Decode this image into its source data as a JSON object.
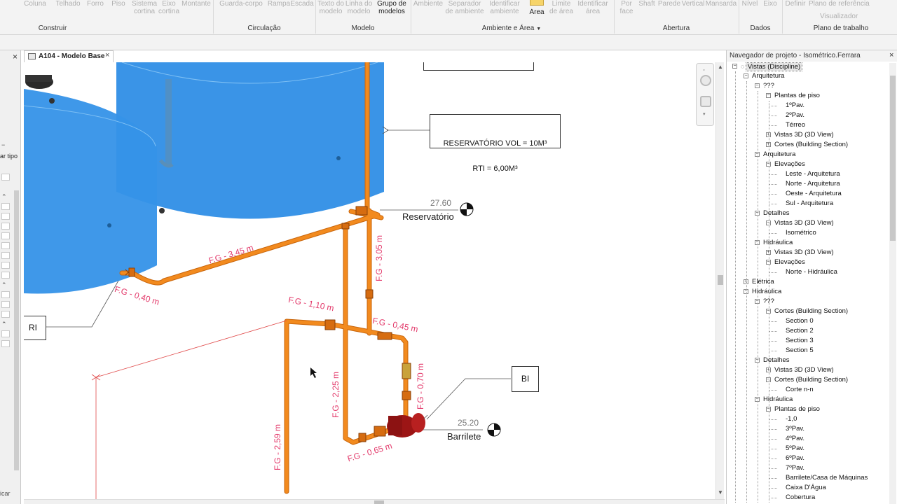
{
  "ribbon": {
    "buttons": [
      {
        "label": "Coluna",
        "active": false
      },
      {
        "label": "Telhado",
        "active": false
      },
      {
        "label": "Forro",
        "active": false
      },
      {
        "label": "Piso",
        "active": false
      },
      {
        "label": "Sistema\ncortina",
        "active": false
      },
      {
        "label": "Eixo\ncortina",
        "active": false
      },
      {
        "label": "Montante",
        "active": false
      },
      {
        "label": "Guarda-corpo",
        "active": false
      },
      {
        "label": "Rampa",
        "active": false
      },
      {
        "label": "Escada",
        "active": false
      },
      {
        "label": "Texto do\nmodelo",
        "active": false
      },
      {
        "label": "Linha do\nmodelo",
        "active": false
      },
      {
        "label": "Grupo de\nmodelos",
        "active": true
      },
      {
        "label": "Ambiente",
        "active": false
      },
      {
        "label": "Separador\nde ambiente",
        "active": false
      },
      {
        "label": "Identificar\nambiente",
        "active": false
      },
      {
        "label": "Área",
        "active": true
      },
      {
        "label": "Limite\nde área",
        "active": false
      },
      {
        "label": "Identificar\nárea",
        "active": false
      },
      {
        "label": "Por\nface",
        "active": false
      },
      {
        "label": "Shaft",
        "active": false
      },
      {
        "label": "Parede",
        "active": false
      },
      {
        "label": "Vertical",
        "active": false
      },
      {
        "label": "Mansarda",
        "active": false
      },
      {
        "label": "Nível",
        "active": false
      },
      {
        "label": "Eixo",
        "active": false
      },
      {
        "label": "Definir",
        "active": false
      },
      {
        "label": "Plano de referência",
        "active": false
      },
      {
        "label": "Visualizador",
        "active": false
      }
    ],
    "panels": [
      "Construir",
      "Circulação",
      "Modelo",
      "Ambiente e Área",
      "Abertura",
      "Dados",
      "Plano de trabalho"
    ]
  },
  "left_panel": {
    "type_label": "ar tipo",
    "footer_label": "icar"
  },
  "view_tab": {
    "label": "A104 - Modelo Base",
    "close": "×"
  },
  "canvas": {
    "pipe_labels": [
      "F.G - 3,45 m",
      "F.G - 0,40 m",
      "F.G - 3,05 m",
      "F.G - 1,10 m",
      "F.G - 0,45 m",
      "F.G - 0,70 m",
      "F.G - 2,25 m",
      "F.G - 2,59 m",
      "F.G - 0,65 m"
    ],
    "reservoir_note_line1": "RESERVATÓRIO VOL = 10M³",
    "reservoir_note_line2": "RTI = 6,00M³",
    "level_reservatorio_value": "27.60",
    "level_reservatorio_name": "Reservatório",
    "level_barrilete_value": "25.20",
    "level_barrilete_name": "Barrilete",
    "tag_bi": "BI",
    "tag_ri": "RI"
  },
  "browser": {
    "title": "Navegador de projeto - Isométrico.Ferrara",
    "close": "×",
    "items": [
      {
        "label": "Vistas (Discipline)",
        "toggle": "-",
        "selected": true
      },
      {
        "label": "Arquitetura",
        "toggle": "-"
      },
      {
        "label": "???",
        "toggle": "-"
      },
      {
        "label": "Plantas de piso",
        "toggle": "-"
      },
      {
        "label": "1ºPav.",
        "toggle": ""
      },
      {
        "label": "2ºPav.",
        "toggle": ""
      },
      {
        "label": "Térreo",
        "toggle": ""
      },
      {
        "label": "Vistas 3D (3D View)",
        "toggle": "+"
      },
      {
        "label": "Cortes (Building Section)",
        "toggle": "+"
      },
      {
        "label": "Arquitetura",
        "toggle": "-"
      },
      {
        "label": "Elevações",
        "toggle": "-"
      },
      {
        "label": "Leste - Arquitetura",
        "toggle": ""
      },
      {
        "label": "Norte - Arquitetura",
        "toggle": ""
      },
      {
        "label": "Oeste - Arquitetura",
        "toggle": ""
      },
      {
        "label": "Sul - Arquitetura",
        "toggle": ""
      },
      {
        "label": "Detalhes",
        "toggle": "-"
      },
      {
        "label": "Vistas 3D (3D View)",
        "toggle": "-"
      },
      {
        "label": "Isométrico",
        "toggle": ""
      },
      {
        "label": "Hidráulica",
        "toggle": "-"
      },
      {
        "label": "Vistas 3D (3D View)",
        "toggle": "+"
      },
      {
        "label": "Elevações",
        "toggle": "-"
      },
      {
        "label": "Norte - Hidráulica",
        "toggle": ""
      },
      {
        "label": "Elétrica",
        "toggle": "+"
      },
      {
        "label": "Hidráulica",
        "toggle": "-"
      },
      {
        "label": "???",
        "toggle": "-"
      },
      {
        "label": "Cortes (Building Section)",
        "toggle": "-"
      },
      {
        "label": "Section 0",
        "toggle": ""
      },
      {
        "label": "Section 2",
        "toggle": ""
      },
      {
        "label": "Section 3",
        "toggle": ""
      },
      {
        "label": "Section 5",
        "toggle": ""
      },
      {
        "label": "Detalhes",
        "toggle": "-"
      },
      {
        "label": "Vistas 3D (3D View)",
        "toggle": "+"
      },
      {
        "label": "Cortes (Building Section)",
        "toggle": "-"
      },
      {
        "label": "Corte n-n",
        "toggle": ""
      },
      {
        "label": "Hidráulica",
        "toggle": "-"
      },
      {
        "label": "Plantas de piso",
        "toggle": "-"
      },
      {
        "label": "-1,0",
        "toggle": ""
      },
      {
        "label": "3ºPav.",
        "toggle": ""
      },
      {
        "label": "4ºPav.",
        "toggle": ""
      },
      {
        "label": "5ºPav.",
        "toggle": ""
      },
      {
        "label": "6ºPav.",
        "toggle": ""
      },
      {
        "label": "7ºPav.",
        "toggle": ""
      },
      {
        "label": "Barrilete/Casa de Máquinas",
        "toggle": ""
      },
      {
        "label": "Caixa D'Água",
        "toggle": ""
      },
      {
        "label": "Cobertura",
        "toggle": ""
      }
    ]
  },
  "colors": {
    "pipe": "#f28a1e",
    "pipe_dark": "#c8650c",
    "tank": "#2f8ee6",
    "tank_light": "#5aa9ef",
    "pump": "#a01818",
    "dimension_text": "#e33a6b",
    "selection": "#e5e5e5"
  }
}
